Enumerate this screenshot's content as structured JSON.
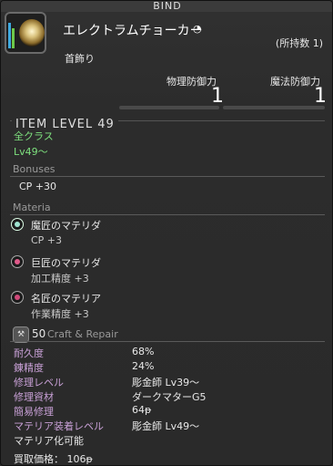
{
  "bind_label": "BIND",
  "item": {
    "icon": "ring-icon",
    "name": "エレクトラムチョーカー",
    "hq_symbol": "&#x2E2F;",
    "owned_label": "(所持数 1)",
    "category": "首飾り"
  },
  "stats": [
    {
      "label": "物理防御力",
      "value": "1"
    },
    {
      "label": "魔法防御力",
      "value": "1"
    }
  ],
  "item_level": "ITEM LEVEL 49",
  "classes": "全クラス",
  "level": "Lv49～",
  "bonuses": {
    "title": "Bonuses",
    "items": [
      "CP +30"
    ]
  },
  "materia": {
    "title": "Materia",
    "slots": [
      {
        "name": "魔匠のマテリダ",
        "stat": "CP +3",
        "color": "#9fe3d0"
      },
      {
        "name": "巨匠のマテリダ",
        "stat": "加工精度 +3",
        "color": "#e05a8a"
      },
      {
        "name": "名匠のマテリア",
        "stat": "作業精度 +3",
        "color": "#d04a7a"
      }
    ]
  },
  "craft_repair": {
    "level": "50",
    "title": "Craft & Repair",
    "rows": [
      {
        "label": "耐久度",
        "value": "68%"
      },
      {
        "label": "錬精度",
        "value": "24%"
      },
      {
        "label": "修理レベル",
        "value": "彫金師 Lv39～"
      },
      {
        "label": "修理資材",
        "value": "ダークマターG5"
      },
      {
        "label": "簡易修理",
        "value": "64ᵽ"
      },
      {
        "label": "マテリア装着レベル",
        "value": "彫金師 Lv49～"
      }
    ],
    "materialize": "マテリア化可能",
    "sell_price": "買取価格： 106ᵽ"
  }
}
